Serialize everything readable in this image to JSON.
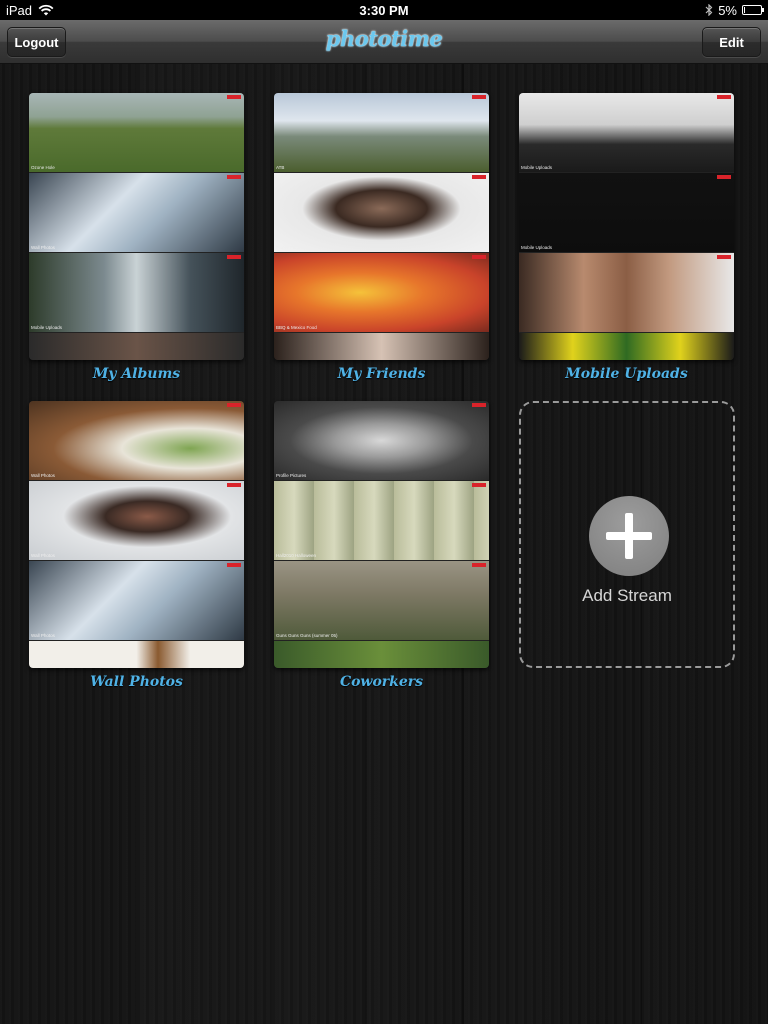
{
  "status_bar": {
    "device": "iPad",
    "time": "3:30 PM",
    "battery": "5%",
    "battery_level": 0.05,
    "icons": [
      "wifi-icon",
      "bluetooth-icon",
      "battery-icon"
    ]
  },
  "nav": {
    "logout_label": "Logout",
    "logo": "phototime",
    "edit_label": "Edit"
  },
  "colors": {
    "title_blue": "#4fb2e6",
    "logo_blue": "#6cc8ee"
  },
  "streams": [
    {
      "title": "My Albums",
      "photos": [
        {
          "caption": "Ozone Hole",
          "bg": "linear-gradient(#a8b6b6 0%, #8fa293 30%, #5f7a3a 45%, #4a6a2b 100%)"
        },
        {
          "caption": "Wall Photos",
          "bg": "linear-gradient(135deg, #3a4652 0%, #d7e1ea 40%, #9fb2c2 60%, #2f3a45 100%)"
        },
        {
          "caption": "Mobile Uploads",
          "bg": "linear-gradient(90deg, #2d3b2a 0%, #7c8a8f 35%, #c9d2d5 50%, #45525a 75%, #1f262b 100%)"
        },
        {
          "caption": "",
          "bg": "linear-gradient(90deg, #2a2a2a, #6a5448, #2a2a2a)"
        }
      ]
    },
    {
      "title": "My Friends",
      "photos": [
        {
          "caption": "ATB",
          "bg": "linear-gradient(#b9c8d8 0%, #dfe6ee 35%, #7a8a7a 55%, #4b5e2e 100%)"
        },
        {
          "caption": "Profile Pictures",
          "bg": "radial-gradient(ellipse at 50% 45%, #8a6a58 0%, #3b2a22 30%, #e8e8e8 52%, #f2f2f2 100%)"
        },
        {
          "caption": "BBQ & Mexico Food",
          "bg": "radial-gradient(ellipse at 40% 50%, #f5c23a 0%, #e7762b 35%, #c9432a 70%, #7a2a1e 100%)"
        },
        {
          "caption": "",
          "bg": "linear-gradient(90deg, #2b211c, #d6c2b4, #2b211c)"
        }
      ]
    },
    {
      "title": "Mobile Uploads",
      "photos": [
        {
          "caption": "Mobile Uploads",
          "bg": "linear-gradient(#e8e8e8 0%, #cfcfcf 40%, #2a2a2a 65%, #1a1a1a 100%)"
        },
        {
          "caption": "Mobile Uploads",
          "bg": "linear-gradient(#111 0%, #0d0d0d 100%)"
        },
        {
          "caption": "",
          "bg": "linear-gradient(90deg, #3a2a22 0%, #b88a6e 30%, #8b5e45 50%, #c29a80 70%, #e8e8e8 100%)"
        },
        {
          "caption": "",
          "bg": "linear-gradient(90deg, #1a1a1a 0%, #e0d21c 25%, #2f6a22 50%, #e0d21c 75%, #1a1a1a 100%)"
        }
      ]
    },
    {
      "title": "Wall Photos",
      "photos": [
        {
          "caption": "Wall Photos",
          "bg": "radial-gradient(ellipse at 75% 60%, #7fa552 0%, #e8e4d8 30%, #8a5a36 60%, #4d3320 100%)"
        },
        {
          "caption": "Wall Photos",
          "bg": "radial-gradient(ellipse at 55% 45%, #8a5a48 0%, #3a2a24 25%, #e2e4e6 50%, #c8ccd0 100%)"
        },
        {
          "caption": "Wall Photos",
          "bg": "linear-gradient(135deg, #3a4652 0%, #d7e1ea 40%, #9fb2c2 60%, #2f3a45 100%)"
        },
        {
          "caption": "",
          "bg": "linear-gradient(90deg, #f2efe9 0%, #f2efe9 50%, #8a5a30 60%, #f2efe9 75%)"
        }
      ]
    },
    {
      "title": "Coworkers",
      "photos": [
        {
          "caption": "Profile Pictures",
          "bg": "radial-gradient(ellipse at 50% 50%, #d8d8d8 0%, #9a9a9a 30%, #4a4a4a 60%, #2a2a2a 100%)"
        },
        {
          "caption": "Hall2010 Halloween",
          "bg": "repeating-linear-gradient(90deg, #b9bc9a 0px, #d7d9bd 20px, #9da382 40px)"
        },
        {
          "caption": "Guns Guns Guns (summer 05)",
          "bg": "linear-gradient(#9a9484 0%, #7f7a66 40%, #4f5a3a 100%)"
        },
        {
          "caption": "",
          "bg": "linear-gradient(90deg, #3a5a2a, #6a8f3a, #3a5a2a)"
        }
      ]
    }
  ],
  "add_stream": {
    "label": "Add Stream"
  }
}
